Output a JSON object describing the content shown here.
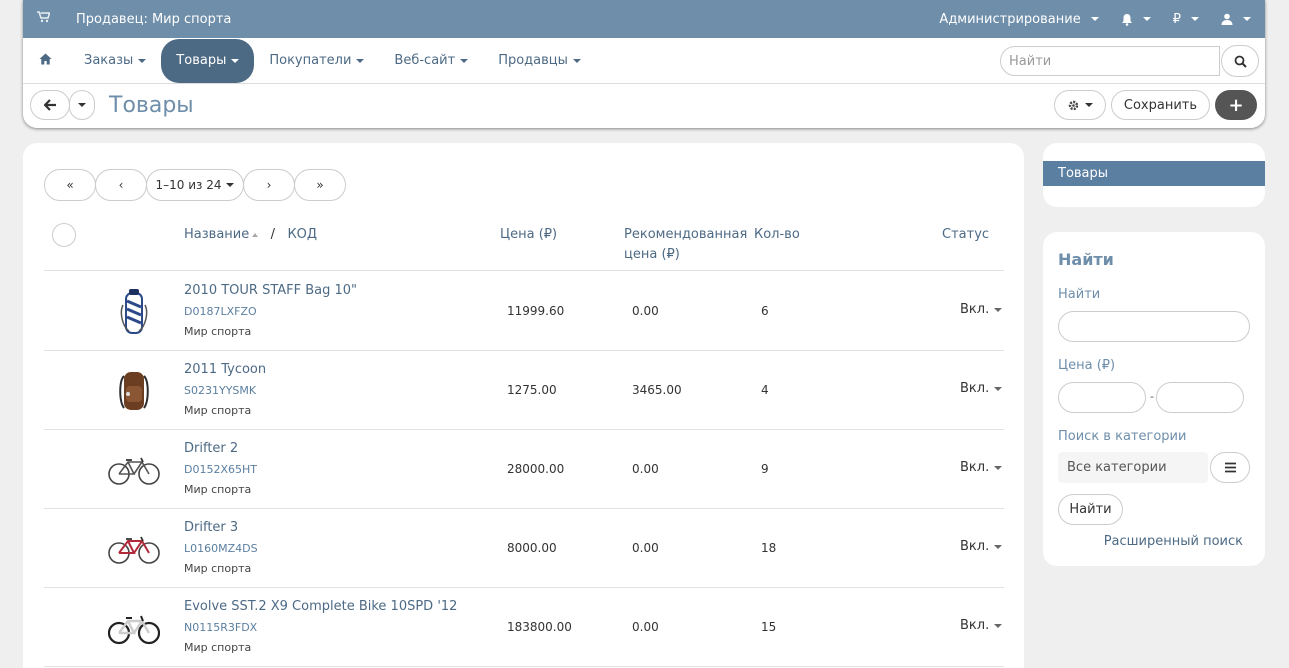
{
  "header": {
    "vendor": "Продавец: Мир спорта",
    "admin": "Администрирование",
    "currency": "₽"
  },
  "nav": {
    "items": [
      "Заказы",
      "Товары",
      "Покупатели",
      "Веб-сайт",
      "Продавцы"
    ],
    "search_placeholder": "Найти"
  },
  "titlebar": {
    "title": "Товары",
    "save": "Сохранить"
  },
  "pager": {
    "first": "«",
    "prev": "‹",
    "range": "1–10 из 24",
    "next": "›",
    "last": "»"
  },
  "table": {
    "col_name": "Название",
    "col_sep": "/",
    "col_code": "КОД",
    "col_price": "Цена (₽)",
    "col_msrp_1": "Рекомендованная",
    "col_msrp_2": "цена (₽)",
    "col_qty": "Кол-во",
    "col_status": "Статус",
    "rows": [
      {
        "name": "2010 TOUR STAFF Bag 10\"",
        "code": "D0187LXFZO",
        "vendor": "Мир спорта",
        "price": "11999.60",
        "msrp": "0.00",
        "qty": "6",
        "status": "Вкл."
      },
      {
        "name": "2011 Tycoon",
        "code": "S0231YYSMK",
        "vendor": "Мир спорта",
        "price": "1275.00",
        "msrp": "3465.00",
        "qty": "4",
        "status": "Вкл."
      },
      {
        "name": "Drifter 2",
        "code": "D0152X65HT",
        "vendor": "Мир спорта",
        "price": "28000.00",
        "msrp": "0.00",
        "qty": "9",
        "status": "Вкл."
      },
      {
        "name": "Drifter 3",
        "code": "L0160MZ4DS",
        "vendor": "Мир спорта",
        "price": "8000.00",
        "msrp": "0.00",
        "qty": "18",
        "status": "Вкл."
      },
      {
        "name": "Evolve SST.2 X9 Complete Bike 10SPD '12",
        "code": "N0115R3FDX",
        "vendor": "Мир спорта",
        "price": "183800.00",
        "msrp": "0.00",
        "qty": "15",
        "status": "Вкл."
      }
    ]
  },
  "sidebar": {
    "tree_item": "Товары",
    "search_title": "Найти",
    "find_label": "Найти",
    "price_label": "Цена (₽)",
    "price_sep": "-",
    "category_label": "Поиск в категории",
    "category_value": "Все категории",
    "find_button": "Найти",
    "advanced": "Расширенный поиск"
  },
  "colors": {
    "topbar": "#6e8eaa",
    "accent": "#4d6a85",
    "active_tree": "#5b7fa0"
  }
}
